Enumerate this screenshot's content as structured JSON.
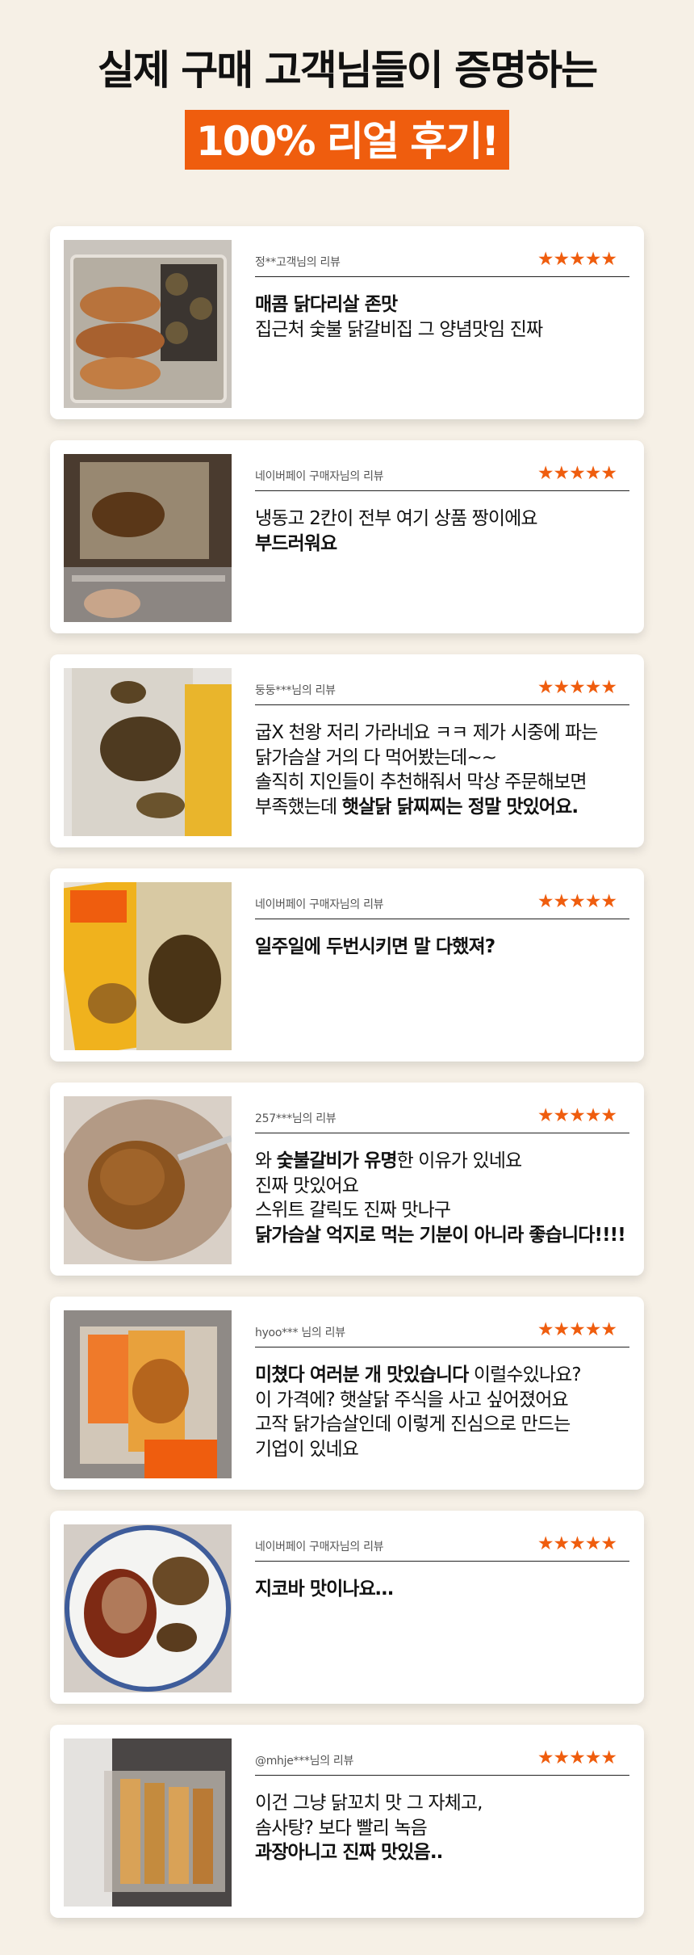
{
  "header": {
    "line1": "실제 구매 고객님들이 증명하는",
    "line2": "100% 리얼 후기!"
  },
  "accent_color": "#ef5d0e",
  "rating_stars": "★★★★★",
  "reviews": [
    {
      "reviewer": "정**고객님의 리뷰",
      "rating": 5,
      "photo": "chicken-breast-rice-box",
      "lines": [
        [
          {
            "t": "매콤 닭다리살 존맛",
            "b": true
          }
        ],
        [
          {
            "t": "집근처 숯불 닭갈비집 그 양념맛임 진짜",
            "b": false
          }
        ]
      ]
    },
    {
      "reviewer": "네이버페이 구매자님의 리뷰",
      "rating": 5,
      "photo": "freezer-drawer-packages",
      "lines": [
        [
          {
            "t": "냉동고 2칸이 전부 여기 상품 짱이에요",
            "b": false
          }
        ],
        [
          {
            "t": "부드러워요",
            "b": true
          }
        ]
      ]
    },
    {
      "reviewer": "둥둥***님의 리뷰",
      "rating": 5,
      "photo": "steamed-chicken-package",
      "lines": [
        [
          {
            "t": "굽X 천왕 저리 가라네요 ㅋㅋ 제가 시중에 파는",
            "b": false
          }
        ],
        [
          {
            "t": "닭가슴살 거의 다 먹어봤는데~~",
            "b": false
          }
        ],
        [
          {
            "t": "솔직히 지인들이 추천해줘서 막상 주문해보면",
            "b": false
          }
        ],
        [
          {
            "t": "부족했는데 ",
            "b": false
          },
          {
            "t": "햇살닭 닭찌찌는 정말 맛있어요.",
            "b": true
          }
        ]
      ]
    },
    {
      "reviewer": "네이버페이 구매자님의 리뷰",
      "rating": 5,
      "photo": "yellow-chicken-package",
      "lines": [
        [
          {
            "t": "일주일에 두번시키면 말 다했져?",
            "b": true
          }
        ]
      ]
    },
    {
      "reviewer": "257***님의 리뷰",
      "rating": 5,
      "photo": "chicken-on-fork",
      "lines": [
        [
          {
            "t": "와 ",
            "b": false
          },
          {
            "t": "숯불갈비가 유명",
            "b": true
          },
          {
            "t": "한 이유가 있네요",
            "b": false
          }
        ],
        [
          {
            "t": "진짜 맛있어요",
            "b": false
          }
        ],
        [
          {
            "t": "스위트 갈릭도 진짜 맛나구",
            "b": false
          }
        ],
        [
          {
            "t": "닭가슴살 억지로 먹는 기분이 아니라 좋습니다!!!!",
            "b": true
          }
        ]
      ]
    },
    {
      "reviewer": "hyoo*** 님의 리뷰",
      "rating": 5,
      "photo": "orange-package-box",
      "lines": [
        [
          {
            "t": "미쳤다 여러분 개 맛있습니다",
            "b": true
          },
          {
            "t": " 이럴수있나요?",
            "b": false
          }
        ],
        [
          {
            "t": "이 가격에? 햇살닭 주식을 사고 싶어졌어요",
            "b": false
          }
        ],
        [
          {
            "t": "고작 닭가슴살인데 이렇게 진심으로 만드는",
            "b": false
          }
        ],
        [
          {
            "t": "기업이 있네요",
            "b": false
          }
        ]
      ]
    },
    {
      "reviewer": "네이버페이 구매자님의 리뷰",
      "rating": 5,
      "photo": "chicken-on-plate",
      "lines": [
        [
          {
            "t": "지코바 맛이나요…",
            "b": true
          }
        ]
      ]
    },
    {
      "reviewer": "@mhje***님의 리뷰",
      "rating": 5,
      "photo": "fridge-door-packages",
      "lines": [
        [
          {
            "t": "이건 그냥 닭꼬치 맛 그 자체고,",
            "b": false
          }
        ],
        [
          {
            "t": "솜사탕? 보다 빨리 녹음",
            "b": false
          }
        ],
        [
          {
            "t": "과장아니고 진짜 맛있음..",
            "b": true
          }
        ]
      ]
    }
  ]
}
